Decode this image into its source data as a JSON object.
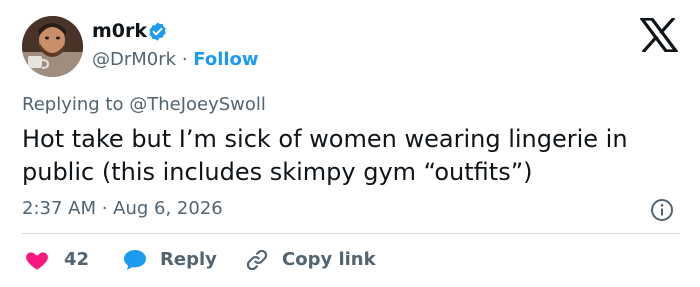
{
  "author": {
    "display_name": "m0rk",
    "handle": "@DrM0rk",
    "separator": "·",
    "follow_label": "Follow"
  },
  "reply_context": {
    "prefix": "Replying to",
    "target_handle": "@TheJoeySwoll"
  },
  "tweet": {
    "text": "Hot take but I’m sick of women wearing lingerie in public (this includes skimpy gym “outfits”)",
    "timestamp": "2:37 AM · Aug 6, 2026"
  },
  "actions": {
    "like_count": "42",
    "reply_label": "Reply",
    "copy_link_label": "Copy link"
  },
  "icons": {
    "verified": "verified-badge-icon",
    "brand": "x-logo-icon",
    "info": "info-icon",
    "like": "heart-icon",
    "reply": "speech-bubble-icon",
    "copy": "link-icon"
  },
  "colors": {
    "accent": "#1d9bf0",
    "like": "#f91880",
    "text": "#0f1419",
    "muted": "#536471"
  }
}
